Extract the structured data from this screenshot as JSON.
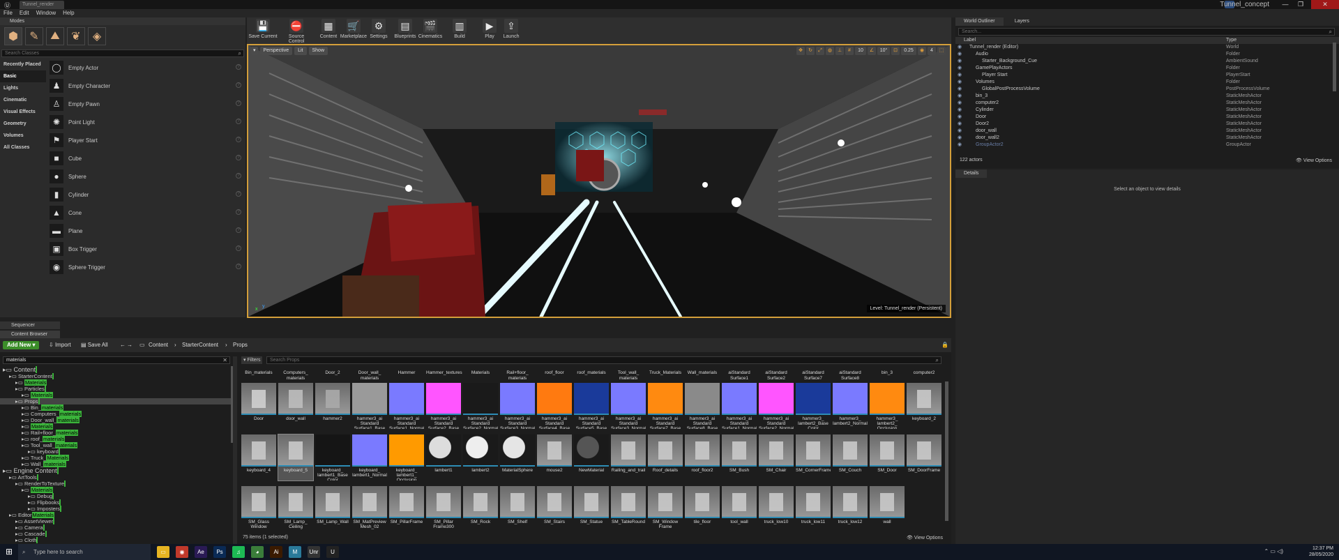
{
  "window": {
    "tab_label": "Tunnel_render",
    "title": "Tunnel_concept",
    "minimize": "—",
    "maximize": "❐",
    "close": "✕"
  },
  "menu": [
    "File",
    "Edit",
    "Window",
    "Help"
  ],
  "modes": {
    "tab": "Modes",
    "search_placeholder": "Search Classes",
    "categories": [
      "Recently Placed",
      "Basic",
      "Lights",
      "Cinematic",
      "Visual Effects",
      "Geometry",
      "Volumes",
      "All Classes"
    ],
    "items": [
      {
        "label": "Empty Actor",
        "glyph": "◯"
      },
      {
        "label": "Empty Character",
        "glyph": "♟"
      },
      {
        "label": "Empty Pawn",
        "glyph": "♙"
      },
      {
        "label": "Point Light",
        "glyph": "✺"
      },
      {
        "label": "Player Start",
        "glyph": "⚑"
      },
      {
        "label": "Cube",
        "glyph": "■"
      },
      {
        "label": "Sphere",
        "glyph": "●"
      },
      {
        "label": "Cylinder",
        "glyph": "▮"
      },
      {
        "label": "Cone",
        "glyph": "▲"
      },
      {
        "label": "Plane",
        "glyph": "▬"
      },
      {
        "label": "Box Trigger",
        "glyph": "▣"
      },
      {
        "label": "Sphere Trigger",
        "glyph": "◉"
      }
    ]
  },
  "toolbar": [
    {
      "label": "Save Current",
      "glyph": "💾",
      "color": "#3a3a3a"
    },
    {
      "label": "Source Control",
      "glyph": "⛔",
      "color": "#3a3a3a"
    },
    {
      "label": "Content",
      "glyph": "▦",
      "color": "#3a3a3a"
    },
    {
      "label": "Marketplace",
      "glyph": "🛒",
      "color": "#3a3a3a"
    },
    {
      "label": "Settings",
      "glyph": "⚙",
      "color": "#3a3a3a"
    },
    {
      "label": "Blueprints",
      "glyph": "▤",
      "color": "#3a3a3a"
    },
    {
      "label": "Cinematics",
      "glyph": "🎬",
      "color": "#3a3a3a"
    },
    {
      "label": "Build",
      "glyph": "▥",
      "color": "#3a3a3a"
    },
    {
      "label": "Play",
      "glyph": "▶",
      "color": "#3a3a3a"
    },
    {
      "label": "Launch",
      "glyph": "⇪",
      "color": "#3a3a3a"
    }
  ],
  "viewport": {
    "perspective": "Perspective",
    "lit": "Lit",
    "show": "Show",
    "grid_snap": "10",
    "rot_snap": "10°",
    "scale_snap": "0.25",
    "cam_speed": "4",
    "level_label": "Level:  Tunnel_render (Persistent)",
    "axis_x": "x",
    "axis_y": "y"
  },
  "outliner": {
    "tab_world": "World Outliner",
    "tab_layers": "Layers",
    "search_placeholder": "Search...",
    "col_label": "Label",
    "col_type": "Type",
    "rows": [
      {
        "label": "Tunnel_render (Editor)",
        "type": "World",
        "indent": 0,
        "glyph": "▾"
      },
      {
        "label": "Audio",
        "type": "Folder",
        "indent": 1,
        "glyph": "▾"
      },
      {
        "label": "Starter_Background_Cue",
        "type": "AmbientSound",
        "indent": 2,
        "glyph": ""
      },
      {
        "label": "GamePlayActors",
        "type": "Folder",
        "indent": 1,
        "glyph": "▾"
      },
      {
        "label": "Player Start",
        "type": "PlayerStart",
        "indent": 2,
        "glyph": ""
      },
      {
        "label": "Volumes",
        "type": "Folder",
        "indent": 1,
        "glyph": "▾"
      },
      {
        "label": "GlobalPostProcessVolume",
        "type": "PostProcessVolume",
        "indent": 2,
        "glyph": ""
      },
      {
        "label": "bin_3",
        "type": "StaticMeshActor",
        "indent": 1,
        "glyph": ""
      },
      {
        "label": "computer2",
        "type": "StaticMeshActor",
        "indent": 1,
        "glyph": ""
      },
      {
        "label": "Cylinder",
        "type": "StaticMeshActor",
        "indent": 1,
        "glyph": ""
      },
      {
        "label": "Door",
        "type": "StaticMeshActor",
        "indent": 1,
        "glyph": ""
      },
      {
        "label": "Door2",
        "type": "StaticMeshActor",
        "indent": 1,
        "glyph": ""
      },
      {
        "label": "door_wall",
        "type": "StaticMeshActor",
        "indent": 1,
        "glyph": ""
      },
      {
        "label": "door_wall2",
        "type": "StaticMeshActor",
        "indent": 1,
        "glyph": ""
      },
      {
        "label": "GroupActor2",
        "type": "GroupActor",
        "indent": 1,
        "glyph": ""
      }
    ],
    "actor_count": "122 actors",
    "view_options": "View Options"
  },
  "details": {
    "tab": "Details",
    "empty": "Select an object to view details"
  },
  "content_browser": {
    "sequencer_tab": "Sequencer",
    "tab": "Content Browser",
    "add_new": "Add New",
    "import": "Import",
    "save_all": "Save All",
    "breadcrumb": [
      "Content",
      "StarterContent",
      "Props"
    ],
    "source_search": "materials",
    "tree": [
      {
        "pre": "Content",
        "hl": "",
        "post": "",
        "indent": 0,
        "big": true
      },
      {
        "pre": "StarterContent",
        "hl": "",
        "post": "",
        "indent": 1
      },
      {
        "pre": "",
        "hl": "Materials",
        "post": "",
        "indent": 2
      },
      {
        "pre": "Particles",
        "hl": "",
        "post": "",
        "indent": 2
      },
      {
        "pre": "",
        "hl": "Materials",
        "post": "",
        "indent": 3
      },
      {
        "pre": "Props",
        "hl": "",
        "post": "",
        "indent": 2,
        "sel": true
      },
      {
        "pre": "Bin_",
        "hl": "materials",
        "post": "",
        "indent": 3
      },
      {
        "pre": "Computers_",
        "hl": "materials",
        "post": "",
        "indent": 3
      },
      {
        "pre": "Door_wall_",
        "hl": "materials",
        "post": "",
        "indent": 3
      },
      {
        "pre": "",
        "hl": "Materials",
        "post": "",
        "indent": 3
      },
      {
        "pre": "Rail+floor_",
        "hl": "materials",
        "post": "",
        "indent": 3
      },
      {
        "pre": "roof_",
        "hl": "materials",
        "post": "",
        "indent": 3
      },
      {
        "pre": "Tool_wall_",
        "hl": "materials",
        "post": "",
        "indent": 3
      },
      {
        "pre": "keyboard",
        "hl": "",
        "post": "",
        "indent": 4
      },
      {
        "pre": "Truck_",
        "hl": "Materials",
        "post": "",
        "indent": 3
      },
      {
        "pre": "Wall_",
        "hl": "materials",
        "post": "",
        "indent": 3
      },
      {
        "pre": "Engine Content",
        "hl": "",
        "post": "",
        "indent": 0,
        "big": true
      },
      {
        "pre": "ArtTools",
        "hl": "",
        "post": "",
        "indent": 1
      },
      {
        "pre": "RenderToTexture",
        "hl": "",
        "post": "",
        "indent": 2
      },
      {
        "pre": "",
        "hl": "Materials",
        "post": "",
        "indent": 3
      },
      {
        "pre": "Debug",
        "hl": "",
        "post": "",
        "indent": 4
      },
      {
        "pre": "Flipbooks",
        "hl": "",
        "post": "",
        "indent": 4
      },
      {
        "pre": "Imposters",
        "hl": "",
        "post": "",
        "indent": 4
      },
      {
        "pre": "Editor",
        "hl": "Materials",
        "post": "",
        "indent": 1
      },
      {
        "pre": "AssetViewer",
        "hl": "",
        "post": "",
        "indent": 2
      },
      {
        "pre": "Camera",
        "hl": "",
        "post": "",
        "indent": 2
      },
      {
        "pre": "Cascade",
        "hl": "",
        "post": "",
        "indent": 2
      },
      {
        "pre": "Cloth",
        "hl": "",
        "post": "",
        "indent": 2
      }
    ],
    "filters": "Filters",
    "asset_search_placeholder": "Search Props",
    "header_row": [
      "Bin_materials",
      "Computers_ materials",
      "Door_2",
      "Door_wall_ materials",
      "Hammer",
      "Hammer_textures",
      "Materials",
      "Rail+floor_ materials",
      "roof_floor",
      "roof_materials",
      "Tool_wall_ materials",
      "Truck_Materials",
      "Wall_materials",
      "aiStandard Surface1",
      "aiStandard Surface2",
      "aiStandard Surface7",
      "aiStandard Surface8",
      "bin_3",
      "computer2"
    ],
    "rows": [
      [
        {
          "label": "Door",
          "c": "#cfcfcf",
          "s": "mesh"
        },
        {
          "label": "door_wall",
          "c": "#bdbdbd",
          "s": "mesh"
        },
        {
          "label": "hammer2",
          "c": "#aaaaaa",
          "s": "mesh"
        },
        {
          "label": "hammer3_ai Standard Surface1_Base",
          "c": "#9a9a9a",
          "s": "flat"
        },
        {
          "label": "hammer3_ai Standard Surface1_Normal",
          "c": "#7a7aff",
          "s": "flat"
        },
        {
          "label": "hammer3_ai Standard Surface2_Base",
          "c": "#ff55ff",
          "s": "flat"
        },
        {
          "label": "hammer3_ai Standard Surface2_Normal",
          "c": "#1a1a1a",
          "s": "flat"
        },
        {
          "label": "hammer3_ai Standard Surface3_Normal",
          "c": "#7a7aff",
          "s": "flat"
        },
        {
          "label": "hammer3_ai Standard Surface4_Base",
          "c": "#ff7a10",
          "s": "flat"
        },
        {
          "label": "hammer3_ai Standard Surface5_Base",
          "c": "#1a3a9a",
          "s": "flat"
        },
        {
          "label": "hammer3_ai Standard Surface3_Normal",
          "c": "#7a7aff",
          "s": "flat"
        },
        {
          "label": "hammer3_ai Standard Surface7_Base",
          "c": "#ff8a10",
          "s": "flat"
        },
        {
          "label": "hammer3_ai Standard Surface8_Base",
          "c": "#8a8a8a",
          "s": "flat"
        },
        {
          "label": "hammer3_ai Standard Surface1_Normal",
          "c": "#7a7aff",
          "s": "flat"
        },
        {
          "label": "hammer3_ai Standard Surface2_Normal",
          "c": "#ff55ff",
          "s": "flat"
        },
        {
          "label": "hammer3_ lambert2_Base Color",
          "c": "#1a3a9a",
          "s": "flat"
        },
        {
          "label": "hammer3_ lambert2_Normal",
          "c": "#7a7aff",
          "s": "flat"
        },
        {
          "label": "hammer3_ lambert2_ Occlusion",
          "c": "#ff8a10",
          "s": "flat"
        },
        {
          "label": "keyboard_2",
          "c": "#c9c9c9",
          "s": "mesh"
        }
      ],
      [
        {
          "label": "keyboard_4",
          "c": "#c9c9c9",
          "s": "mesh"
        },
        {
          "label": "keyboard_5",
          "c": "#c9c9c9",
          "s": "mesh",
          "sel": true
        },
        {
          "label": "keyboard_ lambert1_Base Color",
          "c": "#151515",
          "s": "flat"
        },
        {
          "label": "keyboard_ lambert1_Normal",
          "c": "#7a7aff",
          "s": "flat"
        },
        {
          "label": "keyboard_ lambert1_ Occlusion",
          "c": "#ff9a00",
          "s": "flat"
        },
        {
          "label": "lambert1",
          "c": "#dddddd",
          "s": "sphere"
        },
        {
          "label": "lambert2",
          "c": "#eeeeee",
          "s": "sphere"
        },
        {
          "label": "MaterialSphere",
          "c": "#e5e5e5",
          "s": "sphere"
        },
        {
          "label": "mouse2",
          "c": "#c9c9c9",
          "s": "mesh"
        },
        {
          "label": "NewMaterial",
          "c": "#555555",
          "s": "sphere"
        },
        {
          "label": "Railing_and_trail",
          "c": "#c9c9c9",
          "s": "mesh"
        },
        {
          "label": "Roof_details",
          "c": "#c9c9c9",
          "s": "mesh"
        },
        {
          "label": "roof_floor2",
          "c": "#c9c9c9",
          "s": "mesh"
        },
        {
          "label": "SM_Bush",
          "c": "#c9c9c9",
          "s": "mesh"
        },
        {
          "label": "SM_Chair",
          "c": "#c9c9c9",
          "s": "mesh"
        },
        {
          "label": "SM_CornerFrame",
          "c": "#c9c9c9",
          "s": "mesh"
        },
        {
          "label": "SM_Couch",
          "c": "#c9c9c9",
          "s": "mesh"
        },
        {
          "label": "SM_Door",
          "c": "#c9c9c9",
          "s": "mesh"
        },
        {
          "label": "SM_DoorFrame",
          "c": "#c9c9c9",
          "s": "mesh"
        }
      ],
      [
        {
          "label": "SM_Glass Window",
          "c": "#c9c9c9",
          "s": "mesh"
        },
        {
          "label": "SM_Lamp_ Ceiling",
          "c": "#c9c9c9",
          "s": "mesh"
        },
        {
          "label": "SM_Lamp_Wall",
          "c": "#c9c9c9",
          "s": "mesh"
        },
        {
          "label": "SM_MatPreview Mesh_02",
          "c": "#c9c9c9",
          "s": "mesh"
        },
        {
          "label": "SM_PillarFrame",
          "c": "#c9c9c9",
          "s": "mesh"
        },
        {
          "label": "SM_Pillar Frame300",
          "c": "#c9c9c9",
          "s": "mesh"
        },
        {
          "label": "SM_Rock",
          "c": "#c9c9c9",
          "s": "mesh"
        },
        {
          "label": "SM_Shelf",
          "c": "#c9c9c9",
          "s": "mesh"
        },
        {
          "label": "SM_Stairs",
          "c": "#c9c9c9",
          "s": "mesh"
        },
        {
          "label": "SM_Statue",
          "c": "#c9c9c9",
          "s": "mesh"
        },
        {
          "label": "SM_TableRound",
          "c": "#c9c9c9",
          "s": "mesh"
        },
        {
          "label": "SM_Window Frame",
          "c": "#c9c9c9",
          "s": "mesh"
        },
        {
          "label": "tile_floor",
          "c": "#c9c9c9",
          "s": "mesh"
        },
        {
          "label": "tool_wall",
          "c": "#c9c9c9",
          "s": "mesh"
        },
        {
          "label": "truck_low10",
          "c": "#c9c9c9",
          "s": "mesh"
        },
        {
          "label": "truck_low11",
          "c": "#c9c9c9",
          "s": "mesh"
        },
        {
          "label": "truck_low12",
          "c": "#c9c9c9",
          "s": "mesh"
        },
        {
          "label": "wall",
          "c": "#c9c9c9",
          "s": "mesh"
        }
      ]
    ],
    "item_count": "75 items (1 selected)",
    "view_options": "View Options"
  },
  "taskbar": {
    "search_placeholder": "Type here to search",
    "apps": [
      {
        "name": "file-explorer-icon",
        "glyph": "▭",
        "color": "#e6b422"
      },
      {
        "name": "app-red-icon",
        "glyph": "◉",
        "color": "#c0392b"
      },
      {
        "name": "after-effects-icon",
        "glyph": "Ae",
        "color": "#2a1a55"
      },
      {
        "name": "photoshop-icon",
        "glyph": "Ps",
        "color": "#0a2a55"
      },
      {
        "name": "spotify-icon",
        "glyph": "♫",
        "color": "#1db954"
      },
      {
        "name": "chrome-icon",
        "glyph": "◕",
        "color": "#3a7d3a"
      },
      {
        "name": "illustrator-icon",
        "glyph": "Ai",
        "color": "#3a1a00"
      },
      {
        "name": "app-m-icon",
        "glyph": "M",
        "color": "#2a7a9a"
      },
      {
        "name": "unreal-hub-icon",
        "glyph": "Unr",
        "color": "#333333"
      },
      {
        "name": "unreal-editor-icon",
        "glyph": "U",
        "color": "#222222"
      }
    ],
    "time": "12:37 PM",
    "date": "28/05/2020"
  }
}
